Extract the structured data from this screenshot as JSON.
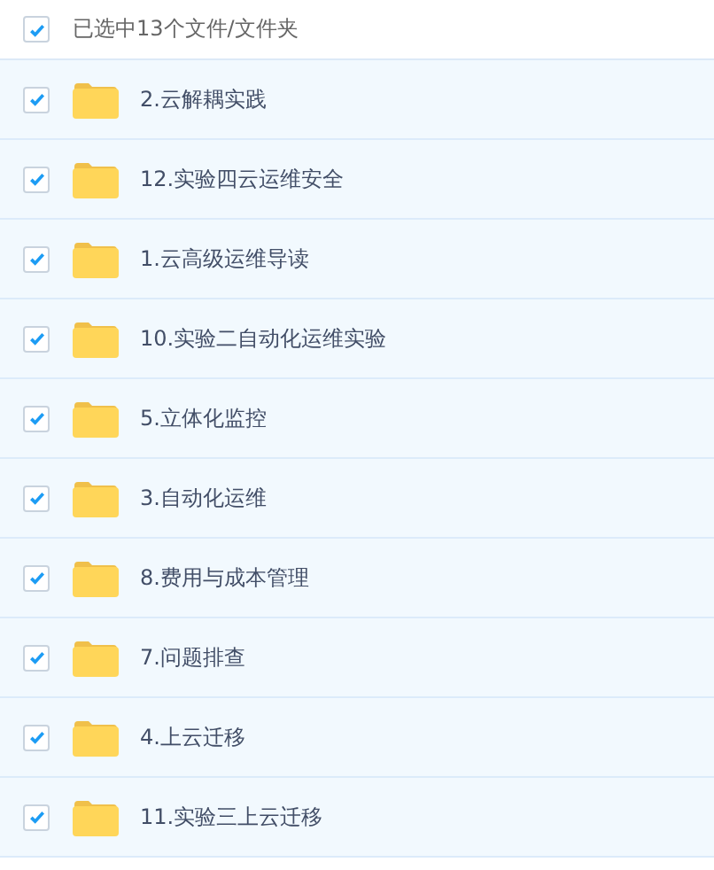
{
  "header": {
    "label": "已选中13个文件/文件夹",
    "checked": true
  },
  "files": [
    {
      "name": "2.云解耦实践",
      "selected": true
    },
    {
      "name": "12.实验四云运维安全",
      "selected": true
    },
    {
      "name": "1.云高级运维导读",
      "selected": true
    },
    {
      "name": "10.实验二自动化运维实验",
      "selected": true
    },
    {
      "name": "5.立体化监控",
      "selected": true
    },
    {
      "name": "3.自动化运维",
      "selected": true
    },
    {
      "name": "8.费用与成本管理",
      "selected": true
    },
    {
      "name": "7.问题排查",
      "selected": true
    },
    {
      "name": "4.上云迁移",
      "selected": true
    },
    {
      "name": "11.实验三上云迁移",
      "selected": true
    }
  ]
}
